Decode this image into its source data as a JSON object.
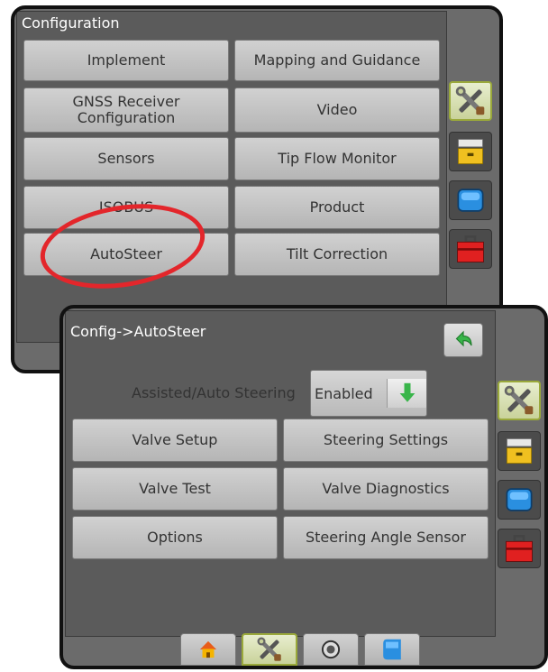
{
  "screen1": {
    "title": "Configuration",
    "buttons": [
      {
        "label": "Implement"
      },
      {
        "label": "Mapping and Guidance"
      },
      {
        "label": "GNSS Receiver Configuration"
      },
      {
        "label": "Video"
      },
      {
        "label": "Sensors"
      },
      {
        "label": "Tip Flow Monitor"
      },
      {
        "label": "ISOBUS"
      },
      {
        "label": "Product"
      },
      {
        "label": "AutoSteer"
      },
      {
        "label": "Tilt Correction"
      }
    ],
    "side_tabs": [
      "tools-icon",
      "cabinet-icon",
      "monitor-icon",
      "toolbox-icon"
    ],
    "highlight_color": "#e3262b"
  },
  "screen2": {
    "title": "Config->AutoSteer",
    "toggle": {
      "label": "Assisted/Auto Steering",
      "value": "Enabled"
    },
    "buttons": [
      {
        "label": "Valve Setup"
      },
      {
        "label": "Steering Settings"
      },
      {
        "label": "Valve Test"
      },
      {
        "label": "Valve Diagnostics"
      },
      {
        "label": "Options"
      },
      {
        "label": "Steering Angle Sensor"
      }
    ],
    "side_tabs": [
      "tools-icon",
      "cabinet-icon",
      "monitor-icon",
      "toolbox-icon"
    ],
    "bottom_tabs": [
      "home-icon",
      "tools-icon",
      "gauge-icon",
      "display-icon"
    ]
  },
  "colors": {
    "accent": "#9aa93b",
    "background": "#6b6b6b",
    "button": "#c4c4c4"
  }
}
